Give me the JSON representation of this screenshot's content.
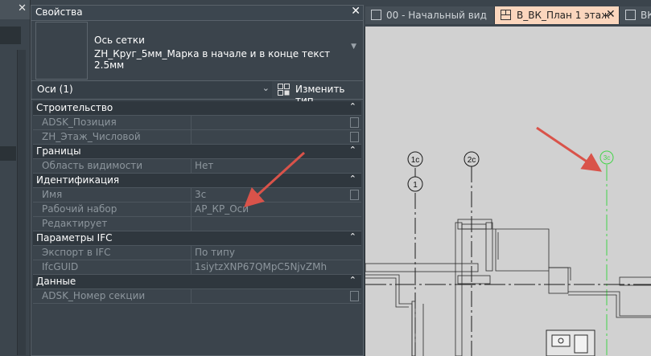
{
  "properties": {
    "title": "Свойства",
    "type_family": "Ось сетки",
    "type_name": "ZH_Круг_5мм_Марка в начале и в конце текст 2.5мм",
    "instance_selector": "Оси (1)",
    "edit_type_label": "Изменить тип",
    "groups": [
      {
        "name": "Строительство",
        "rows": [
          {
            "key": "ADSK_Позиция",
            "value": "",
            "checkbox": true
          },
          {
            "key": "ZH_Этаж_Числовой",
            "value": "",
            "checkbox": true
          }
        ]
      },
      {
        "name": "Границы",
        "rows": [
          {
            "key": "Область видимости",
            "value": "Нет",
            "checkbox": false
          }
        ]
      },
      {
        "name": "Идентификация",
        "rows": [
          {
            "key": "Имя",
            "value": "3с",
            "checkbox": true
          },
          {
            "key": "Рабочий набор",
            "value": "АР_КР_Оси",
            "checkbox": false
          },
          {
            "key": "Редактирует",
            "value": "",
            "checkbox": false
          }
        ]
      },
      {
        "name": "Параметры IFC",
        "rows": [
          {
            "key": "Экспорт в IFC",
            "value": "По типу",
            "checkbox": false
          },
          {
            "key": "IfcGUID",
            "value": "1siytzXNP67QMpC5NjvZMh",
            "checkbox": false
          }
        ]
      },
      {
        "name": "Данные",
        "rows": [
          {
            "key": "ADSK_Номер секции",
            "value": "",
            "checkbox": true
          }
        ]
      }
    ]
  },
  "view_tabs": [
    {
      "label": "00 - Начальный вид",
      "active": false
    },
    {
      "label": "В_ВК_План 1 этаж",
      "active": true
    },
    {
      "label": "ВК",
      "active": false
    }
  ],
  "grid_bubbles": [
    "1с",
    "2с",
    "3с",
    "1"
  ],
  "colors": {
    "active_tab": "#fbd6bd",
    "annotation_arrow": "#d9534a",
    "selected_grid": "#44d44a",
    "canvas": "#d1d1d1"
  }
}
